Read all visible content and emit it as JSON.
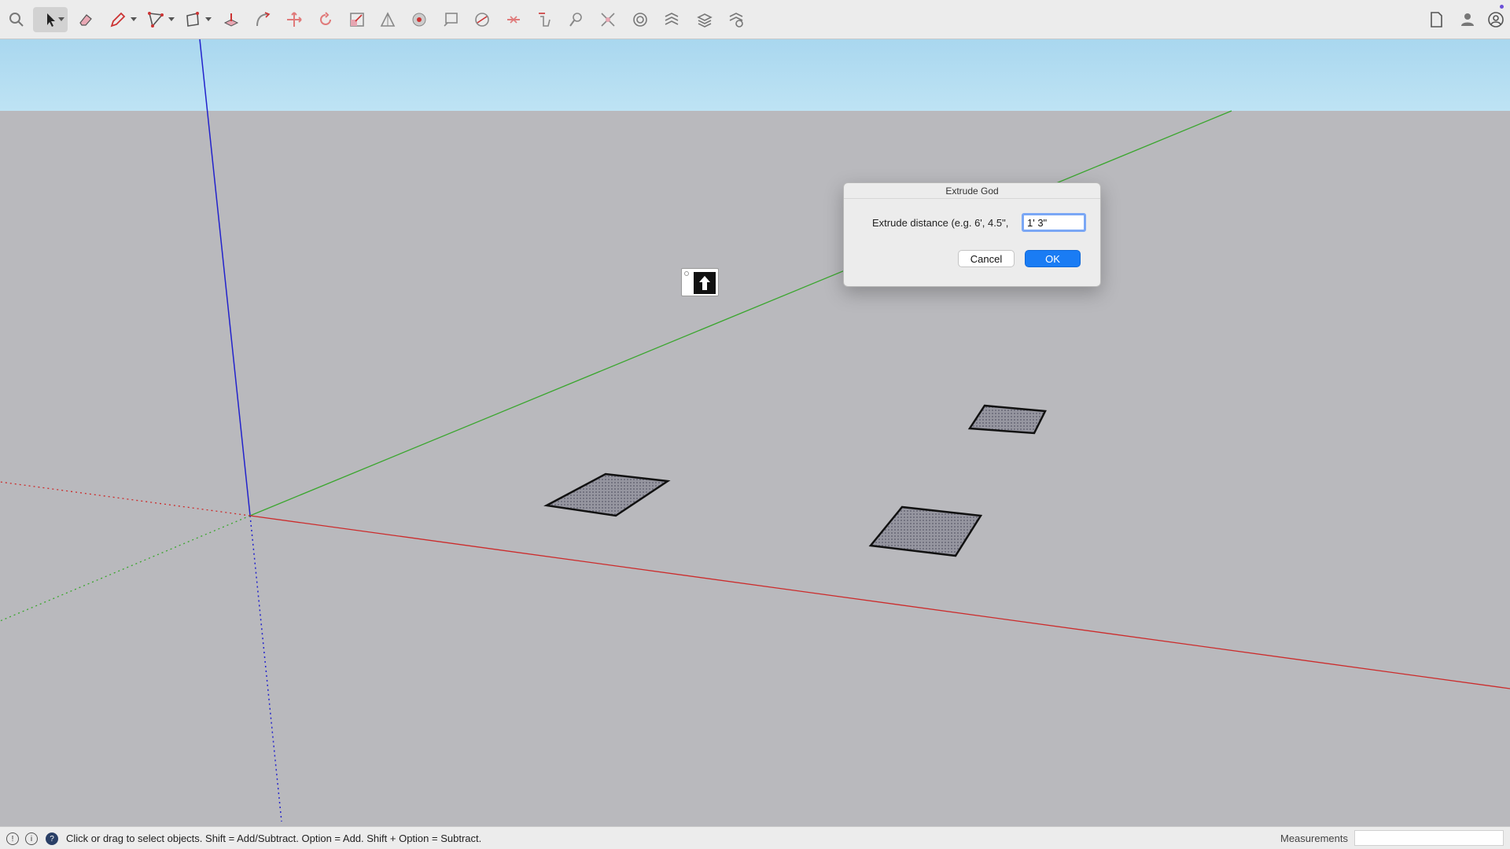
{
  "toolbar": {
    "tools": [
      {
        "name": "search-tool",
        "icon": "magnifier-icon"
      },
      {
        "name": "select-tool",
        "icon": "arrow-cursor-icon",
        "active": true
      },
      {
        "name": "eraser-tool",
        "icon": "eraser-icon"
      },
      {
        "name": "pencil-tool",
        "icon": "pencil-icon"
      },
      {
        "name": "line-tool",
        "icon": "polyline-icon"
      },
      {
        "name": "shape-tool",
        "icon": "rectangle-icon"
      },
      {
        "name": "push-pull-tool",
        "icon": "push-pull-icon"
      },
      {
        "name": "follow-me-tool",
        "icon": "follow-me-icon"
      },
      {
        "name": "move-tool",
        "icon": "move-icon"
      },
      {
        "name": "rotate-tool",
        "icon": "rotate-icon"
      },
      {
        "name": "scale-tool",
        "icon": "scale-icon"
      },
      {
        "name": "tape-measure-tool",
        "icon": "tape-icon"
      },
      {
        "name": "paint-bucket-tool",
        "icon": "paint-icon"
      },
      {
        "name": "text-tool",
        "icon": "text-icon"
      },
      {
        "name": "orbit-tool",
        "icon": "orbit-icon"
      },
      {
        "name": "section-plane-tool",
        "icon": "section-icon"
      },
      {
        "name": "pan-tool",
        "icon": "hand-icon"
      },
      {
        "name": "zoom-tool",
        "icon": "zoom-icon"
      },
      {
        "name": "zoom-extents-tool",
        "icon": "zoom-extents-icon"
      },
      {
        "name": "components-tool",
        "icon": "components-icon"
      },
      {
        "name": "styles-tool",
        "icon": "styles-icon"
      },
      {
        "name": "layers-tool",
        "icon": "layers-icon"
      },
      {
        "name": "scenes-tool",
        "icon": "scenes-icon"
      }
    ],
    "right_icons": [
      "document-icon",
      "user-icon",
      "account-icon"
    ]
  },
  "dialog": {
    "title": "Extrude God",
    "label": "Extrude distance (e.g. 6', 4.5\",",
    "input_value": "1' 3\"",
    "cancel_label": "Cancel",
    "ok_label": "OK"
  },
  "statusbar": {
    "message": "Click or drag to select objects. Shift = Add/Subtract. Option = Add. Shift + Option = Subtract.",
    "measurements_label": "Measurements",
    "measurements_value": ""
  },
  "colors": {
    "red_axis": "#cc2b2b",
    "green_axis": "#3aa62e",
    "blue_axis": "#2222cc",
    "face": "#8f8f98",
    "sky": "#b3ddf2",
    "ground": "#b9b9bd",
    "ok_button": "#1a7cf4"
  }
}
